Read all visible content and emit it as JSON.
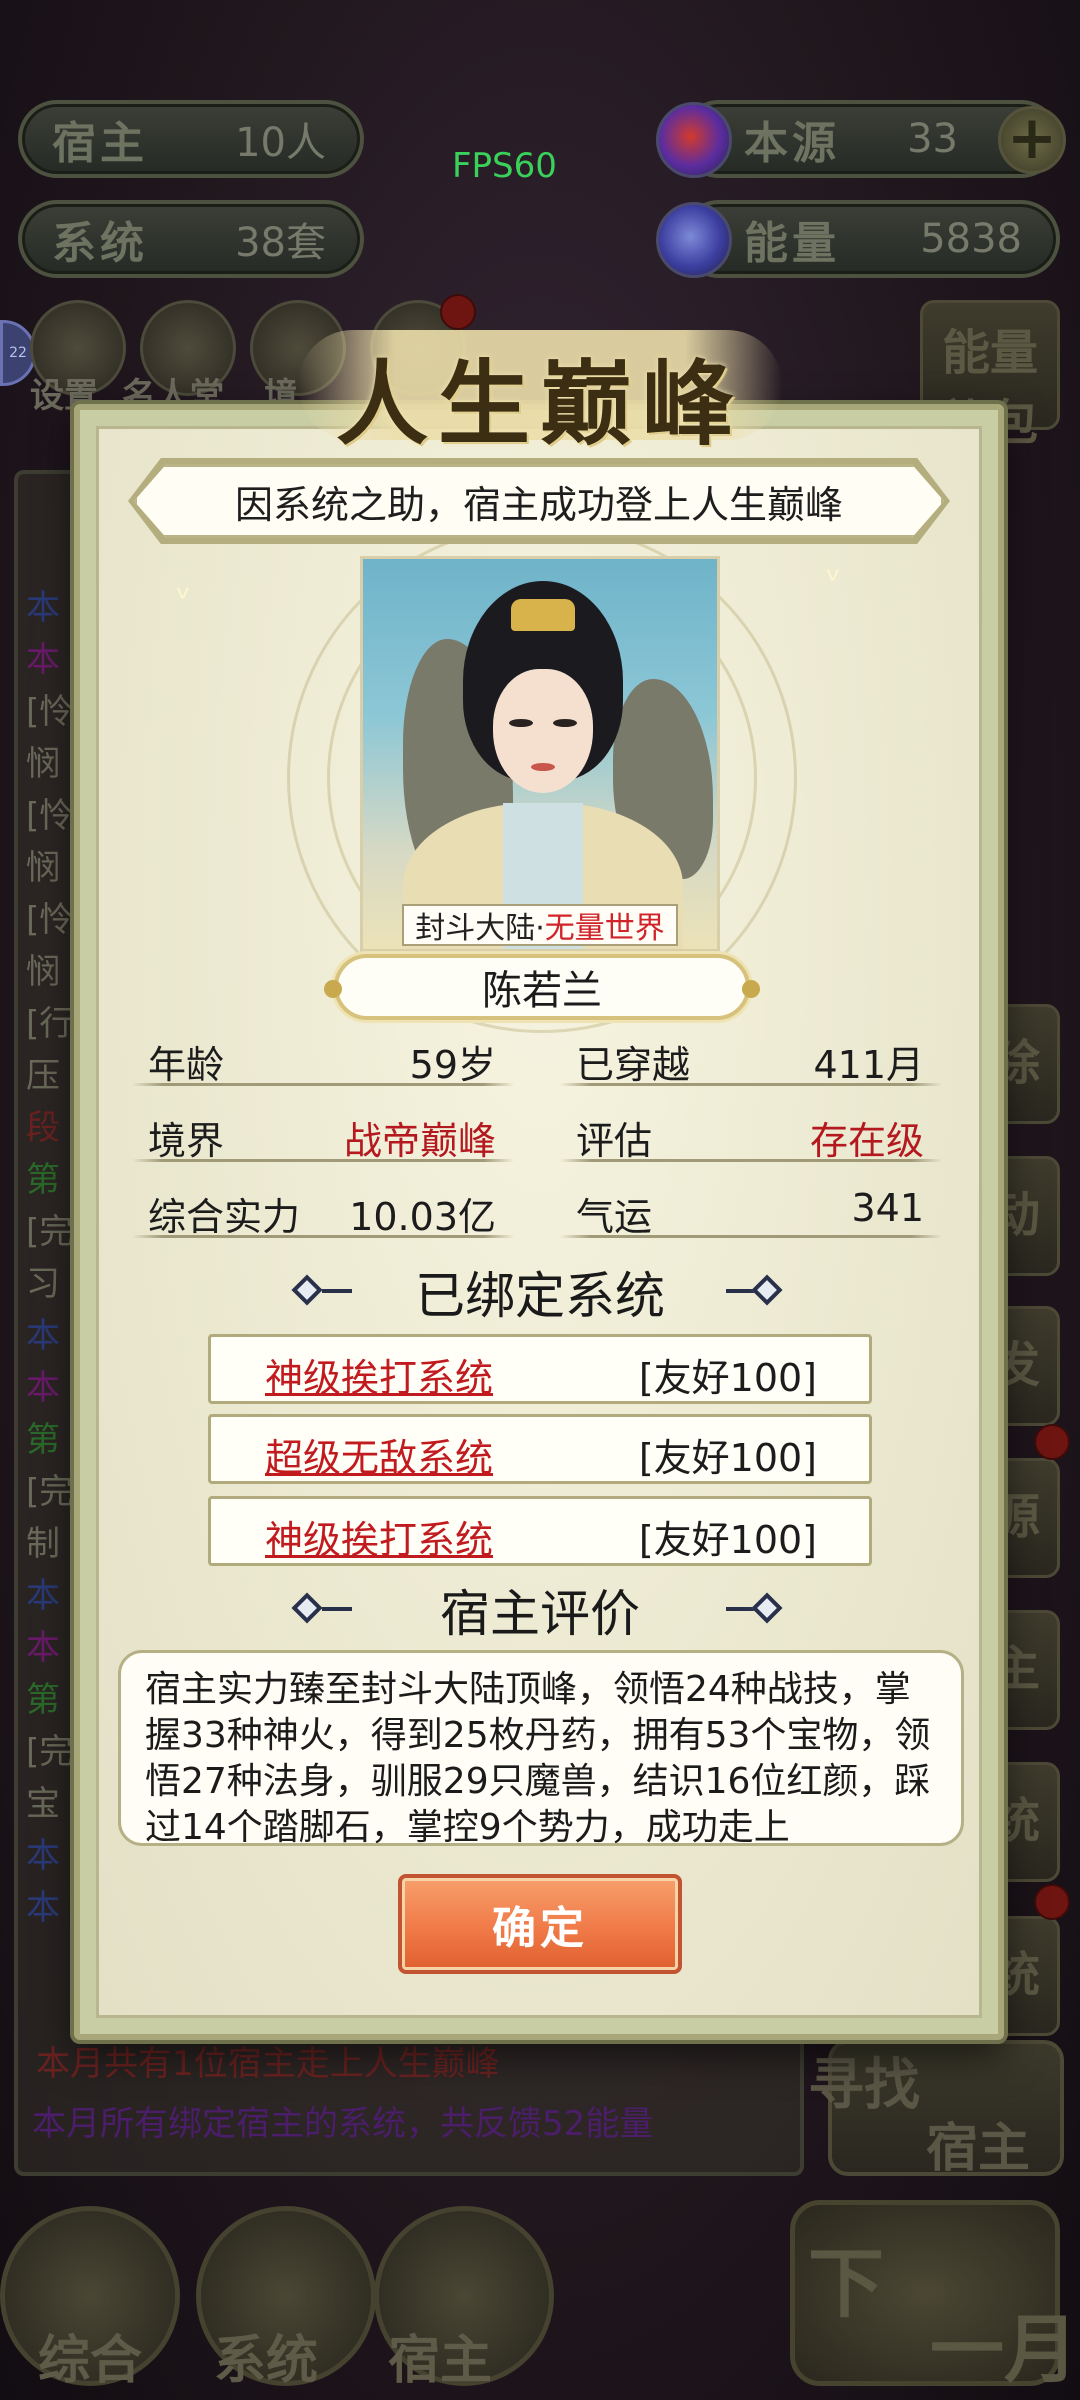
{
  "hud": {
    "host": {
      "label": "宿主",
      "value": "10人"
    },
    "system": {
      "label": "系统",
      "value": "38套"
    },
    "origin": {
      "label": "本源",
      "value": "33"
    },
    "energy": {
      "label": "能量",
      "value": "5838"
    },
    "fps": "FPS60",
    "top_icons": [
      "设置",
      "名人堂",
      "境"
    ],
    "energy_gift": {
      "line1": "能量",
      "line2": "礼包"
    },
    "side_badge": "22"
  },
  "background_log": {
    "lines": [
      "本",
      "本",
      "[怜",
      "悯",
      "[怜",
      "悯",
      "[怜",
      "悯",
      "[行",
      "压",
      "段",
      "第",
      "[完",
      "习",
      "本",
      "本",
      "第",
      "[完",
      "制",
      "本",
      "本",
      "第",
      "[完",
      "宝",
      "本",
      "本"
    ],
    "line_colors": [
      "#2a3a78",
      "#6a1a6a",
      "#6a6a5a",
      "#6a6a5a",
      "#6a6a5a",
      "#6a6a5a",
      "#6a6a5a",
      "#6a6a5a",
      "#6a6a5a",
      "#6a6a5a",
      "#6a2220",
      "#2a6a2a",
      "#6a6a5a",
      "#6a6a5a",
      "#2a3a78",
      "#6a1a6a",
      "#2a6a2a",
      "#6a6a5a",
      "#6a6a5a",
      "#2a3a78",
      "#6a1a6a",
      "#2a6a2a",
      "#6a6a5a",
      "#6a6a5a",
      "#2a3a78",
      "#2a3a78"
    ],
    "bottom_line_1": "本月共有1位宿主走上人生巅峰",
    "bottom_line_2": "本月所有绑定宿主的系统，共反馈52能量"
  },
  "right_buttons": [
    "除",
    "动",
    "发",
    "源",
    "主",
    "统",
    "统"
  ],
  "seek_host": {
    "line1": "寻找",
    "line2": "宿主"
  },
  "bottom_nav": [
    {
      "label": "综合"
    },
    {
      "label": "系统"
    },
    {
      "label": "宿主"
    }
  ],
  "next_month": {
    "line1": "下",
    "line2": "一月"
  },
  "modal": {
    "title": "人生巅峰",
    "subtitle": "因系统之助，宿主成功登上人生巅峰",
    "world_tag_a": "封斗大陆·",
    "world_tag_b": "无量世界",
    "host_name": "陈若兰",
    "stats": [
      {
        "key": "年龄",
        "value": "59岁",
        "highlight": false
      },
      {
        "key": "已穿越",
        "value": "411月",
        "highlight": false
      },
      {
        "key": "境界",
        "value": "战帝巅峰",
        "highlight": true
      },
      {
        "key": "评估",
        "value": "存在级",
        "highlight": true
      },
      {
        "key": "综合实力",
        "value": "10.03亿",
        "highlight": false
      },
      {
        "key": "气运",
        "value": "341",
        "highlight": false
      }
    ],
    "bound_title": "已绑定系统",
    "systems": [
      {
        "name": "神级挨打系统",
        "favor": "[友好100]"
      },
      {
        "name": "超级无敌系统",
        "favor": "[友好100]"
      },
      {
        "name": "神级挨打系统",
        "favor": "[友好100]"
      }
    ],
    "eval_title": "宿主评价",
    "eval_text": "宿主实力臻至封斗大陆顶峰，领悟24种战技，掌握33种神火，得到25枚丹药，拥有53个宝物，领悟27种法身，驯服29只魔兽，结识16位红颜，踩过14个踏脚石，掌控9个势力，成功走上",
    "confirm_label": "确定"
  },
  "colors": {
    "accent_red": "#b3191f",
    "confirm_orange": "#f07a48",
    "fps_green": "#3ad15a"
  }
}
